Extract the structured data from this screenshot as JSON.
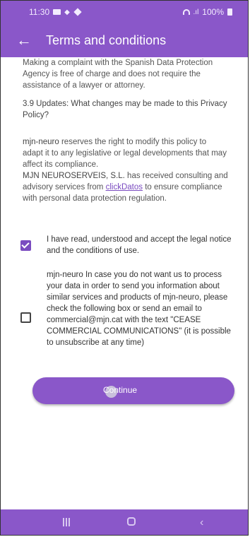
{
  "status_bar": {
    "time": "11:30",
    "battery": "100%",
    "icons": [
      "message-icon",
      "vibrate-icon",
      "heart-icon",
      "wifi-icon",
      "signal-icon",
      "battery-icon"
    ]
  },
  "app_bar": {
    "back_icon": "arrow-left-icon",
    "title": "Terms and conditions"
  },
  "content": {
    "para1": "Making a complaint with the Spanish Data Protection Agency is free of charge and does not require the assistance of a lawyer or attorney.",
    "section_heading": "3.9 Updates: What changes may be made to this Privacy Policy?",
    "para2_brand": "mjn-neuro",
    "para2_text": " reserves the right to modify this policy to adapt it to any legislative or legal developments that may affect its compliance.",
    "para3_company": "MJN NEUROSERVEIS, S.L.",
    "para3_text1": " has received consulting and advisory services from ",
    "para3_link": "clickDatos",
    "para3_text2": " to ensure compliance with personal data protection regulation."
  },
  "checkboxes": [
    {
      "checked": true,
      "label": "I have read, understood and accept the legal notice and the conditions of use."
    },
    {
      "checked": false,
      "label": "mjn-neuro In case you do not want us to process your data in order to send you information about similar services and products of mjn-neuro, please check the following box or send an email to commercial@mjn.cat with the text \"CEASE COMMERCIAL COMMUNICATIONS\" (it is possible to unsubscribe at any time)"
    }
  ],
  "continue_button": {
    "label": "Continue"
  },
  "nav_bar": {
    "icons": [
      "recent-apps-icon",
      "home-icon",
      "back-icon"
    ]
  },
  "colors": {
    "primary": "#8a57c9",
    "link": "#7a4bc0"
  }
}
